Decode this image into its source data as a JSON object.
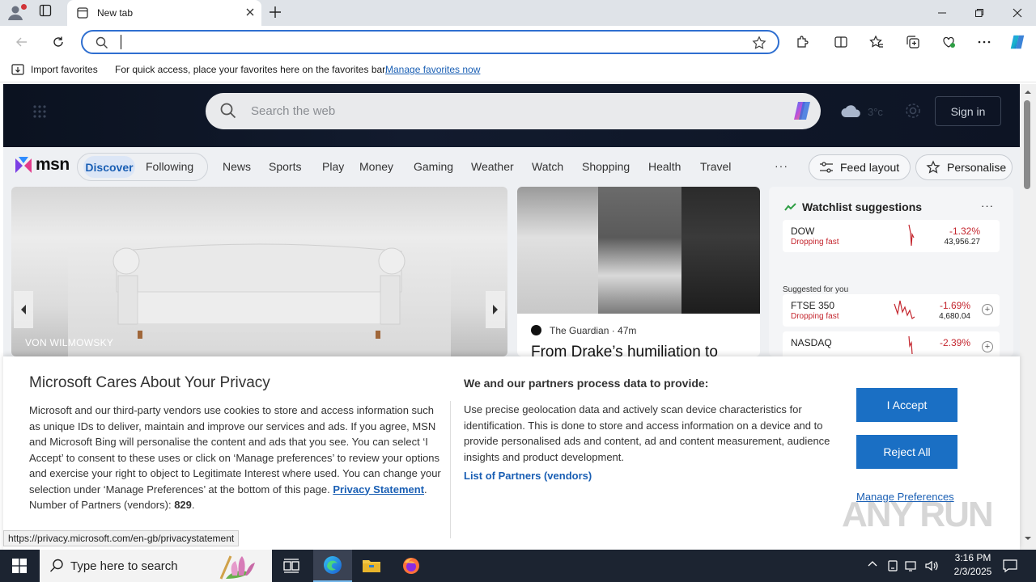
{
  "browser": {
    "tab_title": "New tab",
    "favorites_bar": {
      "import_label": "Import favorites",
      "message": "For quick access, place your favorites here on the favorites bar.",
      "manage_link": "Manage favorites now"
    },
    "status_url": "https://privacy.microsoft.com/en-gb/privacystatement"
  },
  "msn": {
    "search_placeholder": "Search the web",
    "weather_temp": "3°c",
    "signin_label": "Sign in",
    "logo_text": "msn",
    "tabs": {
      "discover": "Discover",
      "following": "Following"
    },
    "nav": [
      "News",
      "Sports",
      "Play",
      "Money",
      "Gaming",
      "Weather",
      "Watch",
      "Shopping",
      "Health",
      "Travel"
    ],
    "more": "···",
    "feed_layout": "Feed layout",
    "personalise": "Personalise",
    "main_card": {
      "source": "VON WILMOWSKY"
    },
    "news_card": {
      "source": "The Guardian · 47m",
      "title": "From Drake’s humiliation to"
    },
    "watchlist": {
      "title": "Watchlist suggestions",
      "more": "···",
      "suggested_label": "Suggested for you",
      "stocks": [
        {
          "symbol": "DOW",
          "status": "Dropping fast",
          "change": "-1.32%",
          "value": "43,956.27"
        },
        {
          "symbol": "FTSE 350",
          "status": "Dropping fast",
          "change": "-1.69%",
          "value": "4,680.04"
        },
        {
          "symbol": "NASDAQ",
          "status": "",
          "change": "-2.39%",
          "value": ""
        }
      ]
    }
  },
  "privacy": {
    "title": "Microsoft Cares About Your Privacy",
    "body": "Microsoft and our third-party vendors use cookies to store and access information such as unique IDs to deliver, maintain and improve our services and ads. If you agree, MSN and Microsoft Bing will personalise the content and ads that you see. You can select ‘I Accept’ to consent to these uses or click on ‘Manage preferences’ to review your options and exercise your right to object to Legitimate Interest where used.  You can change your selection under ‘Manage Preferences’ at the bottom of this page.",
    "privacy_link": "Privacy Statement",
    "partners_count_label": "Number of Partners (vendors):",
    "partners_count": "829",
    "right_title": "We and our partners process data to provide:",
    "right_body": "Use precise geolocation data and actively scan device characteristics for identification. This is done to store and access information on a device and to provide personalised ads and content, ad and content measurement, audience insights and product development.",
    "partners_link": "List of Partners (vendors)",
    "accept": "I Accept",
    "reject": "Reject All",
    "manage": "Manage Preferences"
  },
  "watermark": "ANY RUN",
  "taskbar": {
    "search_placeholder": "Type here to search",
    "time": "3:16 PM",
    "date": "2/3/2025"
  }
}
